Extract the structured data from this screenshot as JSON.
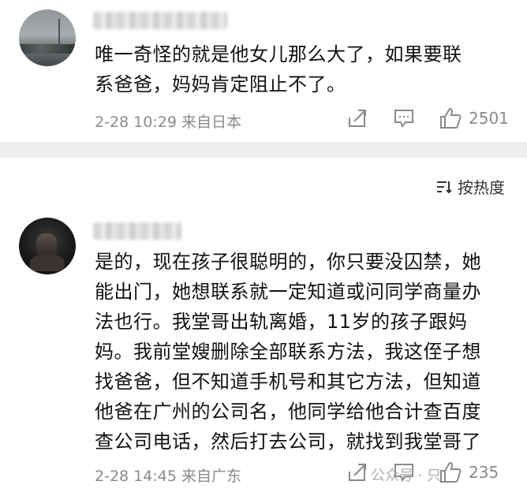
{
  "comments": [
    {
      "lines": [
        "唯一奇怪的就是他女儿那么大了，如果要联",
        "系爸爸，妈妈肯定阻止不了。"
      ],
      "date": "2-28 10:29",
      "location": "来自日本",
      "likes": "2501",
      "icons": {
        "share": "share-icon",
        "comment": "comment-icon",
        "like": "like-icon"
      }
    },
    {
      "lines": [
        "是的，现在孩子很聪明的，你只要没囚禁，她",
        "能出门，她想联系就一定知道或问同学商量办",
        "法也行。我堂哥出轨离婚，11岁的孩子跟妈",
        "妈。我前堂嫂删除全部联系方法，我这侄子想",
        "找爸爸，但不知道手机号和其它方法，但知道",
        "他爸在广州的公司名，他同学给他合计查百度",
        "查公司电话，然后打去公司，就找到我堂哥了"
      ],
      "date": "2-28 14:45",
      "location": "来自广东",
      "likes": "235",
      "icons": {
        "share": "share-icon",
        "comment": "comment-icon",
        "like": "like-icon"
      }
    }
  ],
  "sort": {
    "label": "按热度",
    "icon": "sort-icon"
  },
  "watermark": "公众号 · 只"
}
